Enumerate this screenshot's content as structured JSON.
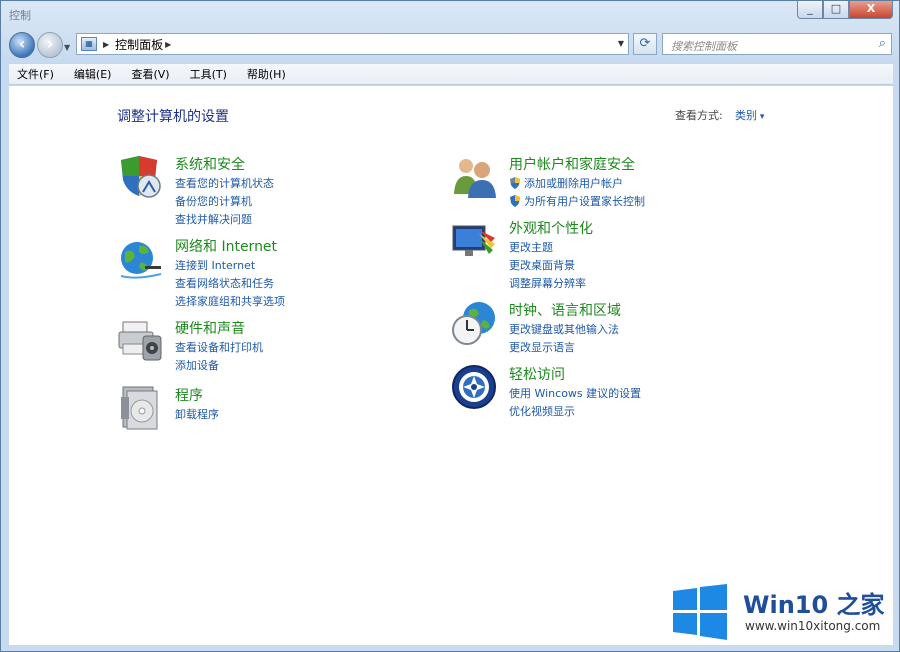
{
  "window": {
    "title": "控制"
  },
  "controls": {
    "minimize": "_",
    "maximize": "□",
    "close": "X"
  },
  "address": {
    "breadcrumb": "控制面板"
  },
  "search": {
    "placeholder": "搜索控制面板"
  },
  "menu": [
    {
      "label": "文件(F)"
    },
    {
      "label": "编辑(E)"
    },
    {
      "label": "查看(V)"
    },
    {
      "label": "工具(T)"
    },
    {
      "label": "帮助(H)"
    }
  ],
  "page": {
    "title": "调整计算机的设置",
    "view_by_label": "查看方式:",
    "view_by_value": "类别"
  },
  "categories": [
    {
      "icon": "system-security-icon",
      "title": "系统和安全",
      "links": [
        "查看您的计算机状态",
        "备份您的计算机",
        "查找并解决问题"
      ]
    },
    {
      "icon": "network-internet-icon",
      "title": "网络和 Internet",
      "links": [
        "连接到 Internet",
        "查看网络状态和任务",
        "选择家庭组和共享选项"
      ]
    },
    {
      "icon": "hardware-sound-icon",
      "title": "硬件和声音",
      "links": [
        "查看设备和打印机",
        "添加设备"
      ]
    },
    {
      "icon": "programs-icon",
      "title": "程序",
      "links": [
        "卸载程序"
      ]
    },
    {
      "icon": "user-accounts-icon",
      "title": "用户帐户和家庭安全",
      "links": [
        "添加或删除用户帐户",
        "为所有用户设置家长控制"
      ]
    },
    {
      "icon": "appearance-icon",
      "title": "外观和个性化",
      "links": [
        "更改主题",
        "更改桌面背景",
        "调整屏幕分辨率"
      ]
    },
    {
      "icon": "clock-region-icon",
      "title": "时钟、语言和区域",
      "links": [
        "更改键盘或其他输入法",
        "更改显示语言"
      ]
    },
    {
      "icon": "ease-of-access-icon",
      "title": "轻松访问",
      "links": [
        "使用 Wincows 建议的设置",
        "优化视频显示"
      ]
    }
  ],
  "brand": {
    "name": "Win10 之家",
    "url": "www.win10xitong.com"
  },
  "colors": {
    "category_title": "#1d8a1d",
    "link": "#1e5aa8",
    "page_title": "#1e3287",
    "brand_blue": "#1f4e9b"
  }
}
